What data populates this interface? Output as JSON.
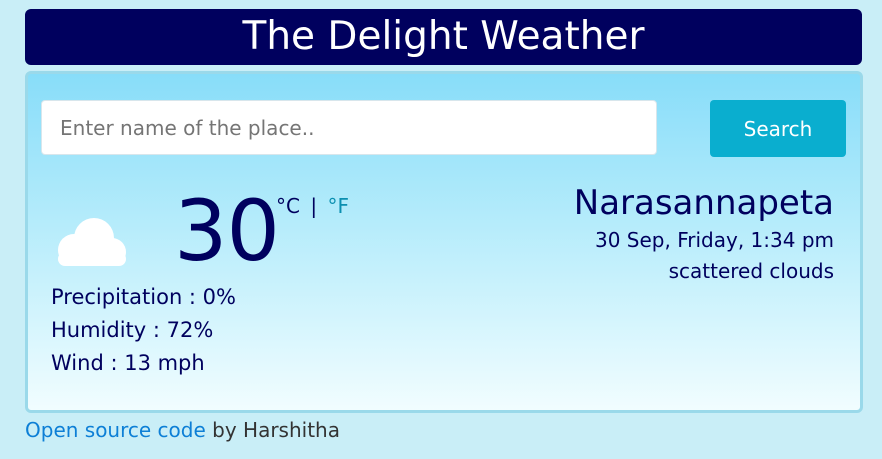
{
  "header": {
    "title": "The Delight Weather"
  },
  "search": {
    "placeholder": "Enter name of the place..",
    "value": "",
    "button_label": "Search"
  },
  "weather": {
    "icon": "cloud-icon",
    "temperature": "30",
    "unit_celsius": "°C",
    "unit_separator": "|",
    "unit_fahrenheit": "°F",
    "precipitation": "Precipitation : 0%",
    "humidity": "Humidity : 72%",
    "wind": "Wind : 13 mph"
  },
  "location": {
    "city": "Narasannapeta",
    "datetime": "30 Sep, Friday, 1:34 pm",
    "condition": "scattered clouds"
  },
  "footer": {
    "link_text": "Open source code",
    "by_text": " by Harshitha"
  },
  "colors": {
    "header_bg": "#00005e",
    "accent": "#0aaecf",
    "text_primary": "#00005e",
    "link": "#0d7fd6",
    "page_bg": "#c9eef7"
  }
}
